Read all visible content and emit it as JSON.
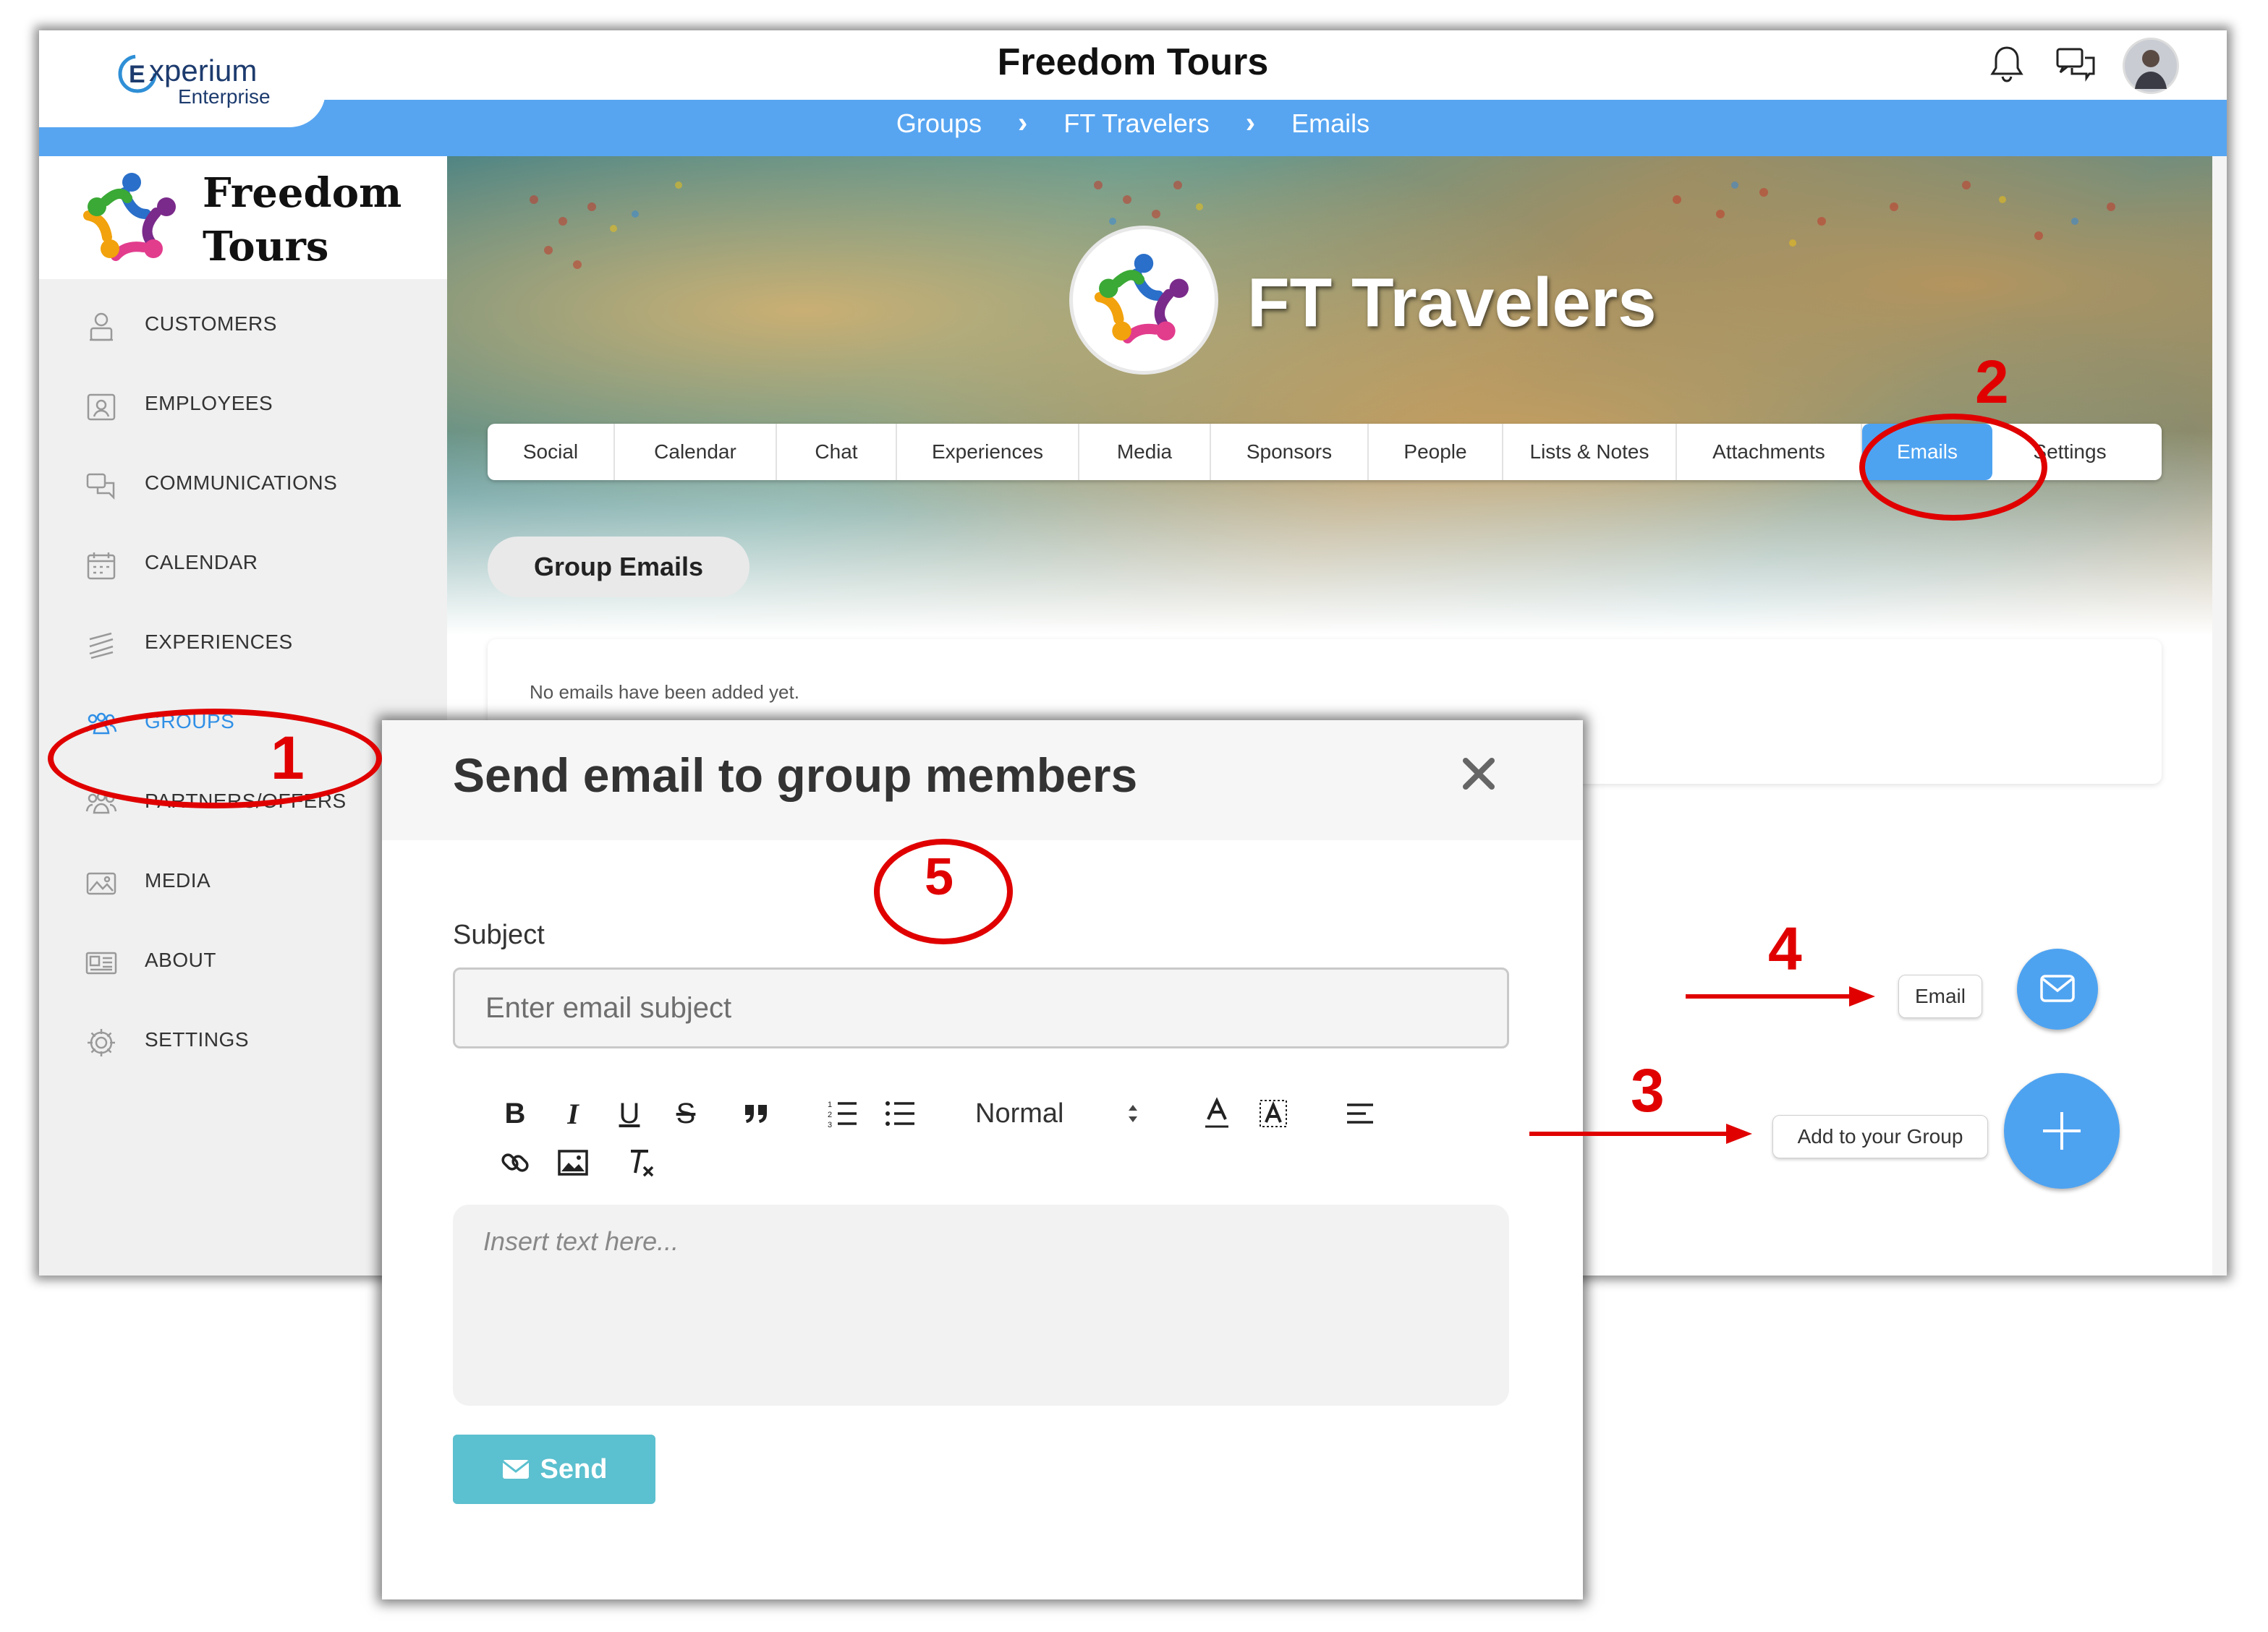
{
  "app": {
    "logo_name": "xperium",
    "logo_initial": "E",
    "logo_sub": "Enterprise",
    "title": "Freedom Tours"
  },
  "breadcrumb": [
    "Groups",
    "FT Travelers",
    "Emails"
  ],
  "sidebar": {
    "brand_line1": "Freedom",
    "brand_line2": "Tours",
    "items": [
      {
        "label": "CUSTOMERS",
        "icon": "customers-icon"
      },
      {
        "label": "EMPLOYEES",
        "icon": "employees-icon"
      },
      {
        "label": "COMMUNICATIONS",
        "icon": "communications-icon"
      },
      {
        "label": "CALENDAR",
        "icon": "calendar-icon"
      },
      {
        "label": "EXPERIENCES",
        "icon": "experiences-icon"
      },
      {
        "label": "GROUPS",
        "icon": "groups-icon",
        "active": true
      },
      {
        "label": "PARTNERS/OFFERS",
        "icon": "partners-icon"
      },
      {
        "label": "MEDIA",
        "icon": "media-icon"
      },
      {
        "label": "ABOUT",
        "icon": "about-icon"
      },
      {
        "label": "SETTINGS",
        "icon": "settings-icon"
      }
    ]
  },
  "group": {
    "name": "FT Travelers",
    "tabs": [
      "Social",
      "Calendar",
      "Chat",
      "Experiences",
      "Media",
      "Sponsors",
      "People",
      "Lists & Notes",
      "Attachments",
      "Emails",
      "Settings"
    ],
    "active_tab": "Emails",
    "section_title": "Group Emails",
    "empty_message": "No emails have been added yet."
  },
  "fab": {
    "email_label": "Email",
    "add_label": "Add to your Group"
  },
  "modal": {
    "title": "Send email to group members",
    "subject_label": "Subject",
    "subject_placeholder": "Enter email subject",
    "format_select": "Normal",
    "editor_placeholder": "Insert text here...",
    "send_label": "Send"
  },
  "annotations": [
    "1",
    "2",
    "3",
    "4",
    "5"
  ],
  "colors": {
    "accent": "#4ea3f1",
    "send_button": "#5bc0cf",
    "annotation_red": "#e00000"
  }
}
